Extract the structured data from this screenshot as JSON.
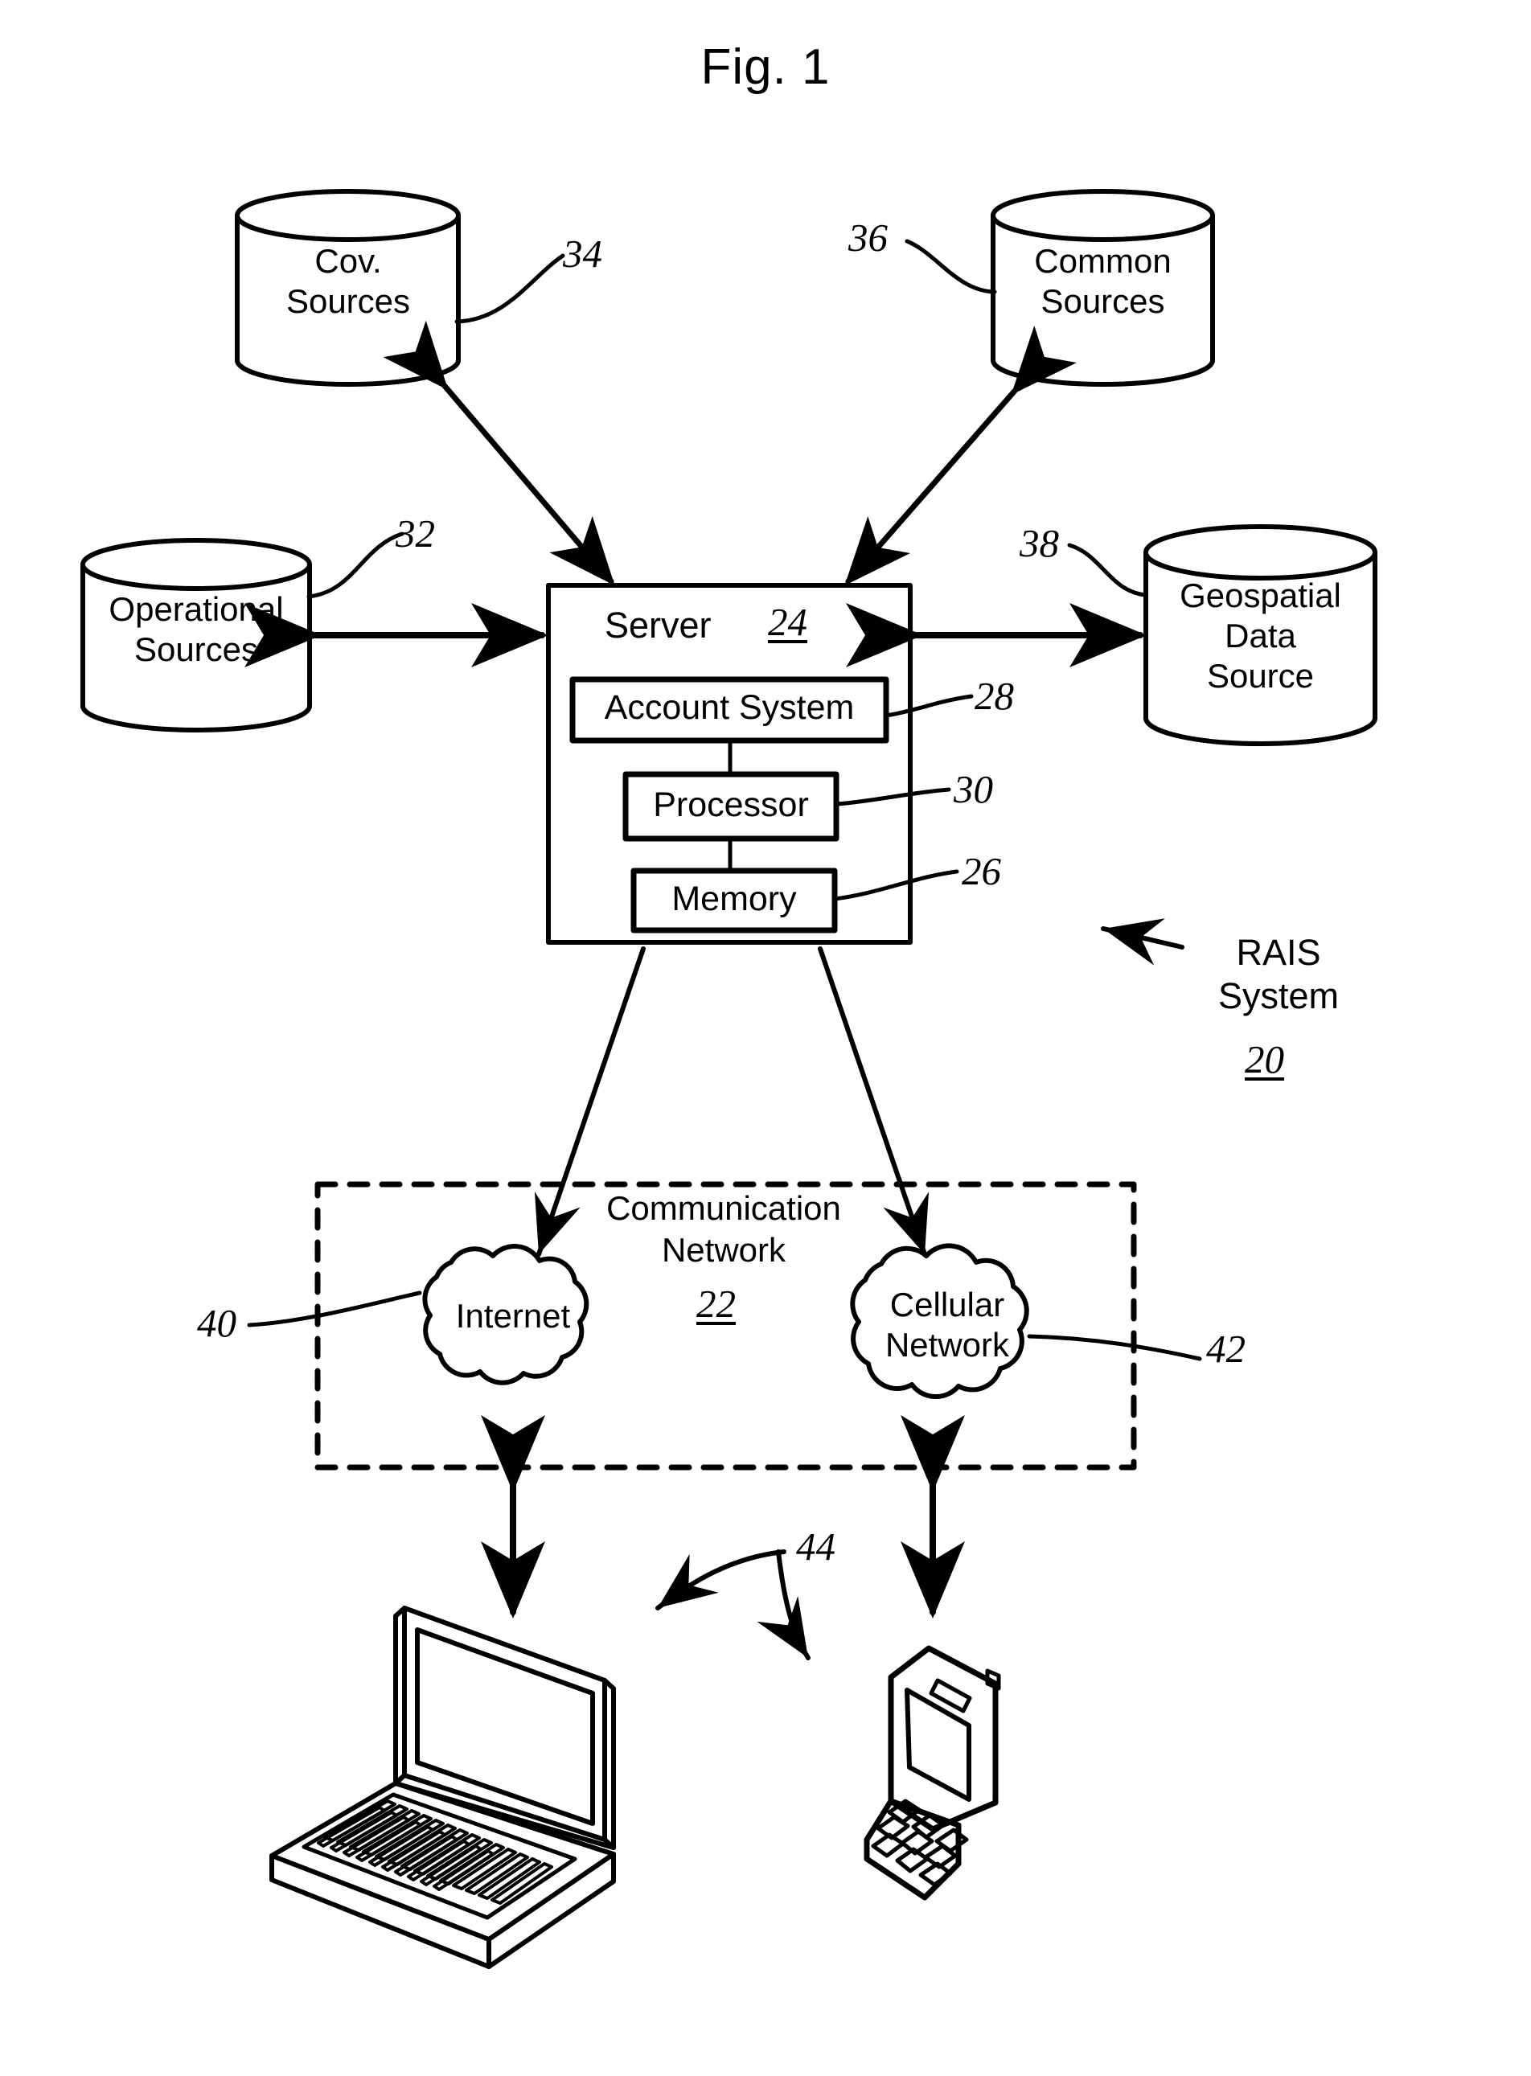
{
  "figure": {
    "title": "Fig. 1",
    "system_name_line1": "RAIS",
    "system_name_line2": "System",
    "system_ref": "20"
  },
  "nodes": {
    "cov_sources": {
      "label": "Cov.\nSources",
      "ref": "34",
      "shape": "cylinder"
    },
    "common_sources": {
      "label": "Common\nSources",
      "ref": "36",
      "shape": "cylinder"
    },
    "operational_sources": {
      "label": "Operational\nSources",
      "ref": "32",
      "shape": "cylinder"
    },
    "geospatial_data_source": {
      "label": "Geospatial\nData\nSource",
      "ref": "38",
      "shape": "cylinder"
    },
    "server": {
      "label": "Server",
      "ref": "24",
      "shape": "rectangle",
      "components": [
        {
          "label": "Account System",
          "ref": "28"
        },
        {
          "label": "Processor",
          "ref": "30"
        },
        {
          "label": "Memory",
          "ref": "26"
        }
      ]
    },
    "communication_network": {
      "label_line1": "Communication",
      "label_line2": "Network",
      "ref": "22",
      "shape": "dashed-rectangle",
      "clouds": [
        {
          "label": "Internet",
          "ref": "40"
        },
        {
          "label": "Cellular\nNetwork",
          "ref": "42"
        }
      ]
    },
    "devices": {
      "ref": "44",
      "items": [
        {
          "name": "laptop"
        },
        {
          "name": "mobile-phone"
        }
      ]
    }
  },
  "colors": {
    "ink": "#000000",
    "paper": "#ffffff"
  }
}
